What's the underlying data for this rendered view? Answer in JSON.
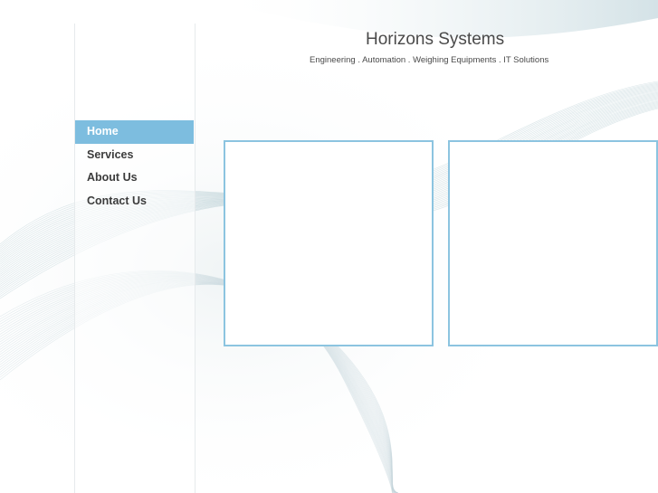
{
  "site": {
    "title": "Horizons Systems",
    "tagline": "Engineering . Automation . Weighing  Equipments . IT Solutions"
  },
  "nav": {
    "items": [
      {
        "label": "Home",
        "active": true
      },
      {
        "label": "Services",
        "active": false
      },
      {
        "label": "About Us",
        "active": false
      },
      {
        "label": "Contact Us",
        "active": false
      }
    ]
  },
  "colors": {
    "accent": "#7dbddf",
    "panel_border": "#8cc4e0",
    "text": "#3c3c3c",
    "wave": "#b9cfd6"
  }
}
